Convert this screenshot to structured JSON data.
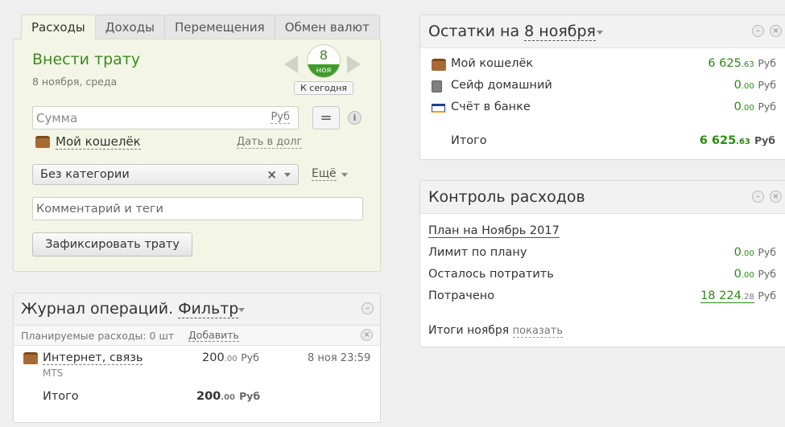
{
  "tabs": [
    "Расходы",
    "Доходы",
    "Перемещения",
    "Обмен валют"
  ],
  "form": {
    "title": "Внести трату",
    "date_text": "8 ноября, среда",
    "day": "8",
    "month_short": "ноя",
    "today_label": "К сегодня",
    "amount_placeholder": "Сумма",
    "currency": "Руб",
    "calc_symbol": "=",
    "info_symbol": "i",
    "wallet": "Мой кошелёк",
    "debt_link": "Дать в долг",
    "category": "Без категории",
    "category_clear": "×",
    "more": "Ещё",
    "comment_placeholder": "Комментарий и теги",
    "submit": "Зафиксировать трату"
  },
  "journal": {
    "title": "Журнал операций.",
    "filter": "Фильтр",
    "min_symbol": "–",
    "close_symbol": "×",
    "planned_text": "Планируемые расходы: 0 шт",
    "planned_add": "Добавить",
    "operation": {
      "name": "Интернет, связь",
      "sub": "MTS",
      "amount_int": "200",
      "amount_dec": ".00",
      "currency": "Руб",
      "time": "8 ноя 23:59"
    },
    "total_label": "Итого",
    "total_int": "200",
    "total_dec": ".00",
    "total_currency": "Руб"
  },
  "balances": {
    "title_prefix": "Остатки на",
    "title_date": "8 ноября",
    "min_symbol": "–",
    "close_symbol": "×",
    "accounts": [
      {
        "name": "Мой кошелёк",
        "int": "6 625",
        "dec": ".63",
        "currency": "Руб",
        "icon": "wallet-icon"
      },
      {
        "name": "Сейф домашний",
        "int": "0",
        "dec": ".00",
        "currency": "Руб",
        "icon": "safe-icon"
      },
      {
        "name": "Счёт в банке",
        "int": "0",
        "dec": ".00",
        "currency": "Руб",
        "icon": "visa-card-icon"
      }
    ],
    "total_label": "Итого",
    "total_int": "6 625",
    "total_dec": ".63",
    "total_currency": "Руб"
  },
  "control": {
    "title": "Контроль расходов",
    "min_symbol": "–",
    "close_symbol": "×",
    "plan_link": "План на Ноябрь 2017",
    "rows": [
      {
        "label": "Лимит по плану",
        "int": "0",
        "dec": ".00",
        "currency": "Руб"
      },
      {
        "label": "Осталось потратить",
        "int": "0",
        "dec": ".00",
        "currency": "Руб"
      },
      {
        "label": "Потрачено",
        "int": "18 224",
        "dec": ".28",
        "currency": "Руб"
      }
    ],
    "month_total_label": "Итоги ноября",
    "show_link": "показать"
  },
  "colors": {
    "accent_green": "#3d8a1f",
    "amount_green": "#2c8a14",
    "form_bg": "#f3f6e6"
  }
}
